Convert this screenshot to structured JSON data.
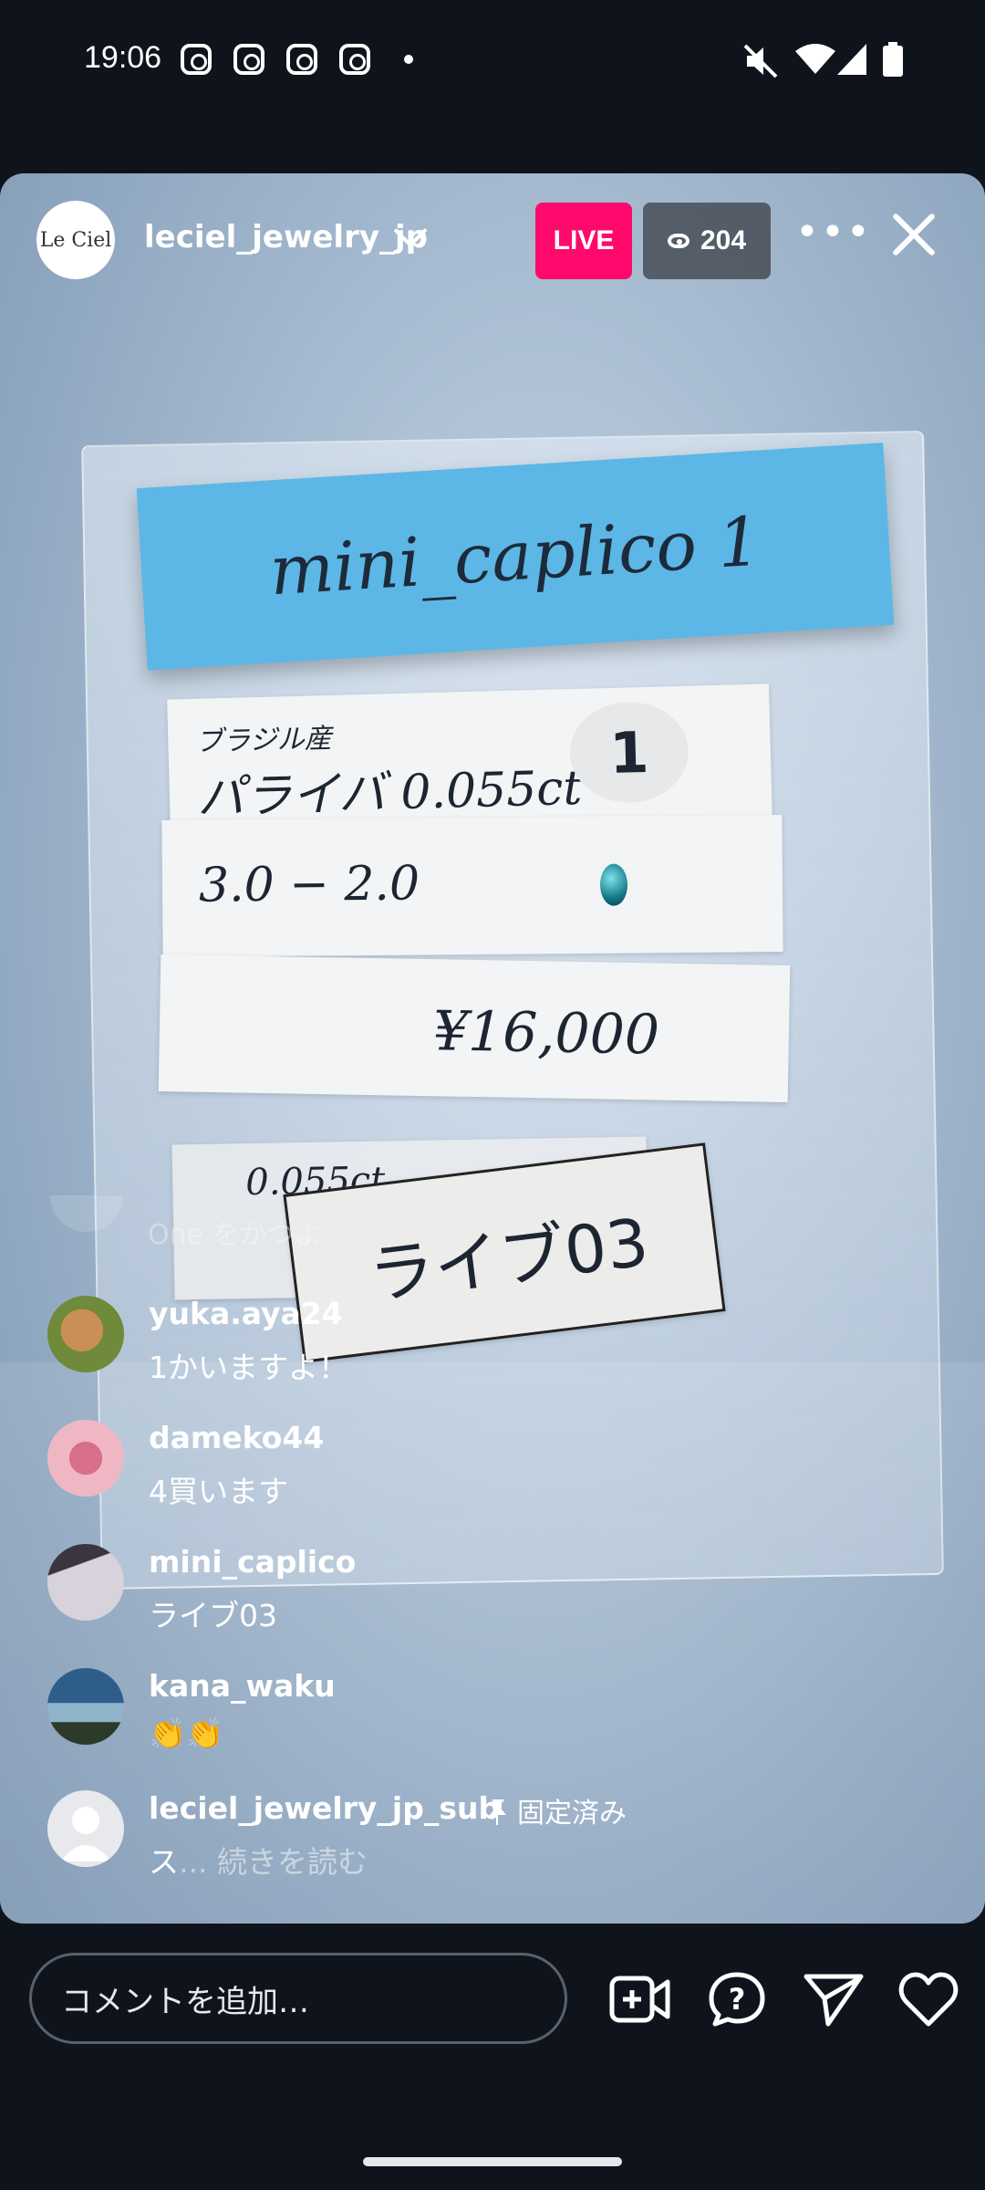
{
  "status_bar": {
    "time": "19:06",
    "notification_icons": [
      "instagram-icon",
      "instagram-icon",
      "instagram-icon",
      "instagram-icon",
      "dot-icon"
    ],
    "right_icons": [
      "mute-icon",
      "wifi-icon",
      "signal-icon",
      "battery-icon"
    ]
  },
  "header": {
    "avatar_text": "Le Ciel",
    "username": "leciel_jewelry_jp",
    "live_label": "LIVE",
    "viewer_count": "204",
    "more_label": "•••"
  },
  "video": {
    "label_blue": "mini_caplico 1",
    "paper1_small": "ブラジル産",
    "paper1_main": "パライバ 0.055ct",
    "paper1_number": "1",
    "paper2_main": "3.0 − 2.0",
    "paper3_main": "¥16,000",
    "paper4_main": "0.055ct",
    "paper5_main": "ライブ03"
  },
  "comments": {
    "faded_text": "One をかつよ",
    "items": [
      {
        "username": "yuka.aya24",
        "text": "1かいますよ！",
        "avatar_color": "#6f8a3a"
      },
      {
        "username": "dameko44",
        "text": "4買います",
        "avatar_color": "#e7a8b7"
      },
      {
        "username": "mini_caplico",
        "text": "ライブ03",
        "avatar_color": "#b9b3bf"
      },
      {
        "username": "kana_waku",
        "text": "👏👏",
        "avatar_color": "#5a8fb0"
      }
    ],
    "pinned": {
      "username": "leciel_jewelry_jp_sub",
      "pinned_label": "固定済み",
      "text": "ス",
      "more": "... 続きを読む"
    }
  },
  "bottom_bar": {
    "input_placeholder": "コメントを追加…",
    "icons": [
      "add-video-icon",
      "question-icon",
      "send-icon",
      "heart-icon"
    ]
  }
}
